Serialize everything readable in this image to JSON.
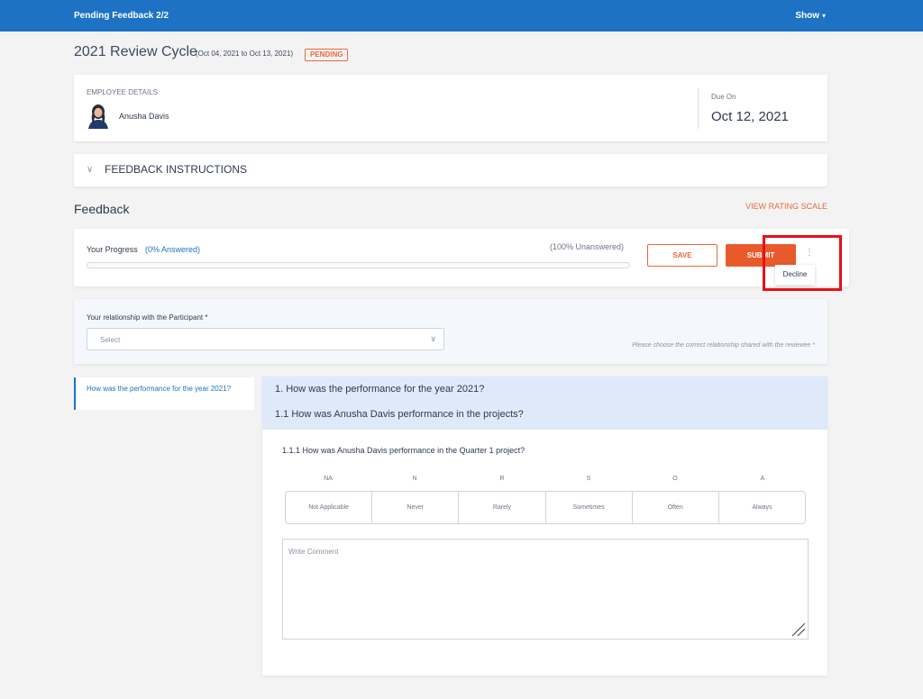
{
  "topbar": {
    "title": "Pending Feedback 2/2",
    "show_label": "Show",
    "accent": "#1d72c4"
  },
  "cycle": {
    "title": "2021 Review Cycle",
    "dates": "(Oct 04, 2021 to Oct 13, 2021)",
    "status": "PENDING"
  },
  "employee": {
    "section_label": "EMPLOYEE DETAILS",
    "name": "Anusha Davis",
    "due_label": "Due On",
    "due_date": "Oct 12, 2021"
  },
  "instructions": {
    "label": "FEEDBACK INSTRUCTIONS"
  },
  "feedback": {
    "heading": "Feedback",
    "rating_link": "VIEW RATING SCALE"
  },
  "progress": {
    "label": "Your Progress",
    "answered": "(0% Answered)",
    "unanswered": "(100% Unanswered)",
    "fraction_answered": 0,
    "save_label": "SAVE",
    "submit_label": "SUBMIT",
    "decline_label": "Decline"
  },
  "relationship": {
    "label": "Your relationship with the Participant *",
    "select_value": "Select",
    "hint": "Please choose the correct relationship shared with the reviewee *"
  },
  "question_nav": {
    "items": [
      "How was the performance for the year 2021?"
    ]
  },
  "question": {
    "title": "1. How was the performance for the year 2021?",
    "subtitle": "1.1 How was Anusha Davis performance in the projects?",
    "question": "1.1.1 How was Anusha Davis performance in the Quarter 1 project?",
    "scale": [
      {
        "abbr": "NA",
        "label": "Not Applicable"
      },
      {
        "abbr": "N",
        "label": "Never"
      },
      {
        "abbr": "R",
        "label": "Rarely"
      },
      {
        "abbr": "S",
        "label": "Sometimes"
      },
      {
        "abbr": "O",
        "label": "Often"
      },
      {
        "abbr": "A",
        "label": "Always"
      }
    ],
    "comment_placeholder": "Write Comment"
  },
  "colors": {
    "orange": "#e86a3c",
    "submit": "#e85a2c",
    "highlight": "#e8101a",
    "question_header_bg": "#deeafa"
  }
}
